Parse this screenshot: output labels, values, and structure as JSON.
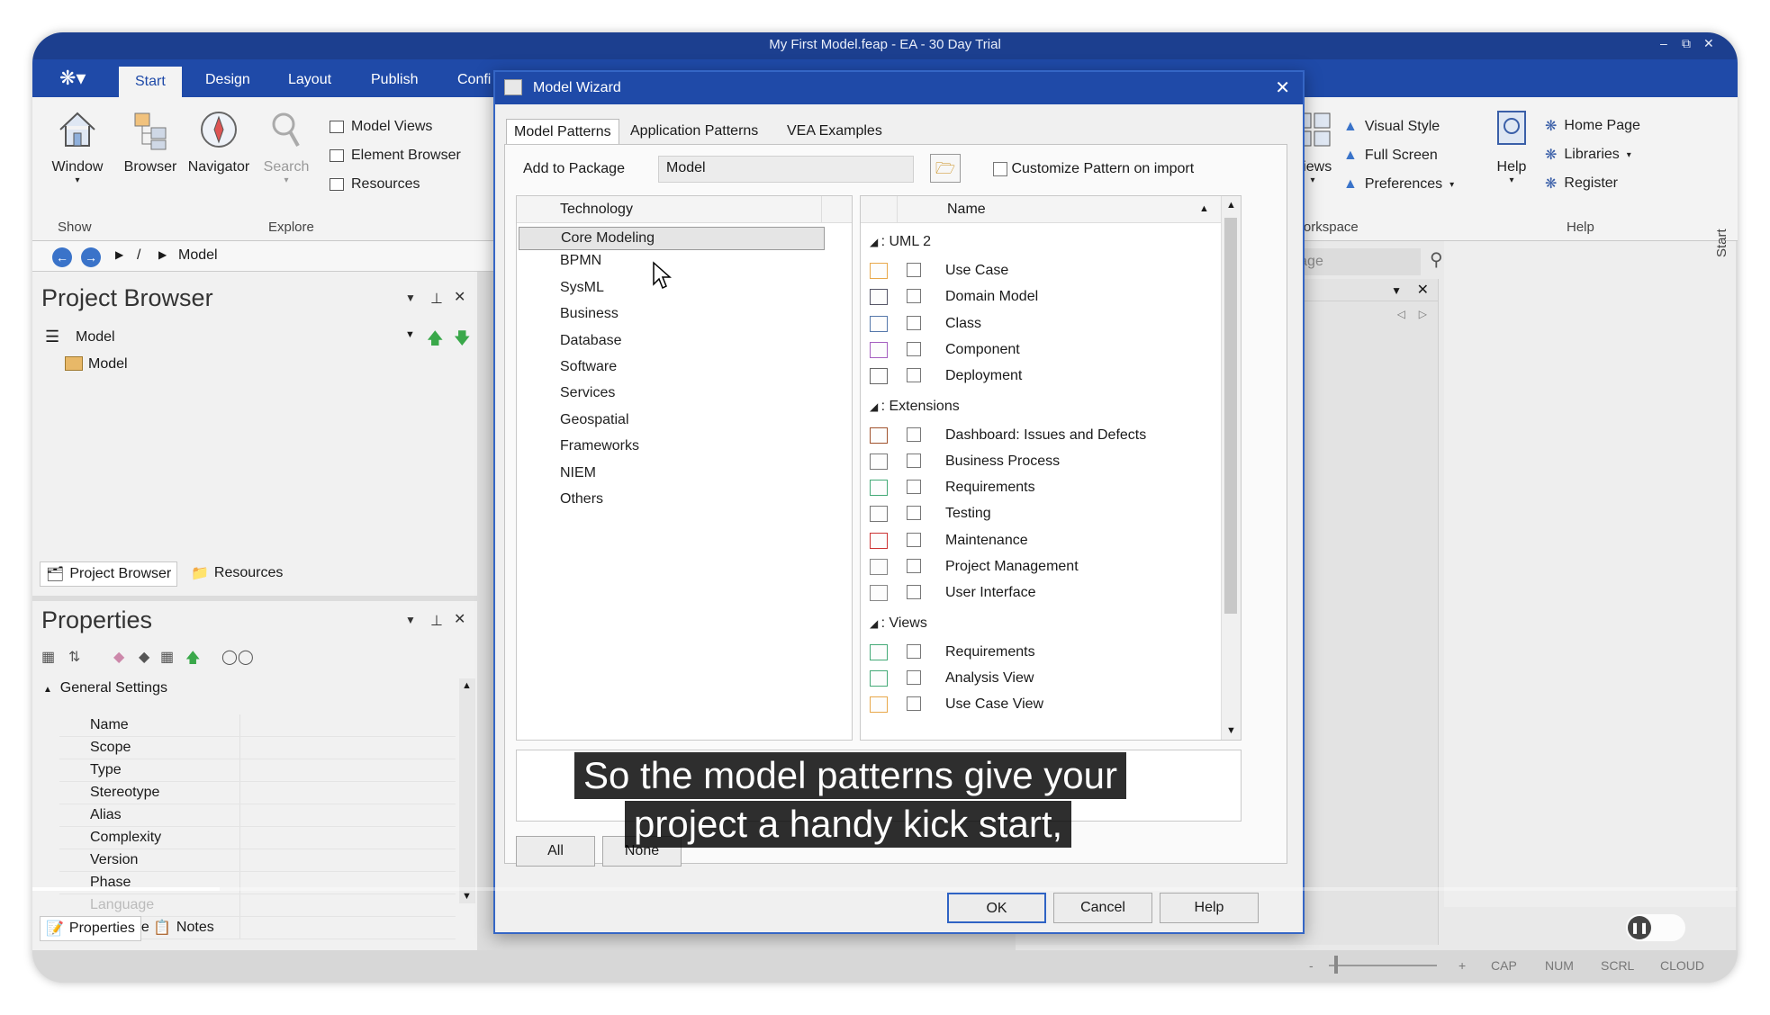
{
  "window": {
    "title": "My First Model.feap - EA - 30 Day Trial"
  },
  "ribbon": {
    "tabs": [
      "Start",
      "Design",
      "Layout",
      "Publish",
      "Confi"
    ],
    "show": {
      "window_label": "Window",
      "group_label": "Show"
    },
    "explore": {
      "browser_label": "Browser",
      "navigator_label": "Navigator",
      "search_label": "Search",
      "model_views_label": "Model Views",
      "element_browser_label": "Element Browser",
      "resources_label": "Resources",
      "group_label": "Explore"
    },
    "workspace": {
      "views_partial": "es",
      "views_label": "Views",
      "visual_style_label": "Visual Style",
      "full_screen_label": "Full Screen",
      "preferences_label": "Preferences",
      "group_label": "Workspace"
    },
    "help": {
      "help_label": "Help",
      "home_page_label": "Home Page",
      "libraries_label": "Libraries",
      "register_label": "Register",
      "group_label": "Help"
    }
  },
  "breadcrumb": {
    "separator": "/",
    "current": "Model"
  },
  "find_package": {
    "placeholder": "Find Package"
  },
  "side_tab": {
    "label": "Start"
  },
  "project_browser": {
    "title": "Project Browser",
    "root_label": "Model",
    "tree_item": "Model",
    "tabs": [
      "Project Browser",
      "Resources"
    ]
  },
  "properties": {
    "title": "Properties",
    "section": "General Settings",
    "rows": [
      "Name",
      "Scope",
      "Type",
      "Stereotype",
      "Alias",
      "Complexity",
      "Version",
      "Phase",
      "Language",
      "Filename"
    ],
    "tabs": [
      "Properties",
      "Notes"
    ]
  },
  "dialog": {
    "title": "Model Wizard",
    "tabs": [
      "Model Patterns",
      "Application Patterns",
      "VEA Examples"
    ],
    "add_to_package_label": "Add to Package",
    "package_value": "Model",
    "customize_label": "Customize Pattern on import",
    "technology_header": "Technology",
    "technologies": [
      "Core Modeling",
      "BPMN",
      "SysML",
      "Business",
      "Database",
      "Software",
      "Services",
      "Geospatial",
      "Frameworks",
      "NIEM",
      "Others"
    ],
    "name_header": "Name",
    "groups": [
      {
        "label": ": UML 2",
        "items": [
          "Use Case",
          "Domain Model",
          "Class",
          "Component",
          "Deployment"
        ]
      },
      {
        "label": ": Extensions",
        "items": [
          "Dashboard: Issues and Defects",
          "Business Process",
          "Requirements",
          "Testing",
          "Maintenance",
          "Project Management",
          "User Interface"
        ]
      },
      {
        "label": ": Views",
        "items": [
          "Requirements",
          "Analysis View",
          "Use Case View"
        ]
      }
    ],
    "all_button": "All",
    "none_button": "None",
    "ok_button": "OK",
    "cancel_button": "Cancel",
    "help_button": "Help"
  },
  "caption": {
    "line1": "So the model patterns give your",
    "line2": "project a handy kick start,"
  },
  "video": {
    "progress": 0.11
  },
  "statusbar": {
    "items": [
      "-",
      "+",
      "CAP",
      "NUM",
      "SCRL",
      "CLOUD"
    ]
  },
  "colors": {
    "accent": "#1f4aa8",
    "dialog_border": "#3566c5"
  }
}
